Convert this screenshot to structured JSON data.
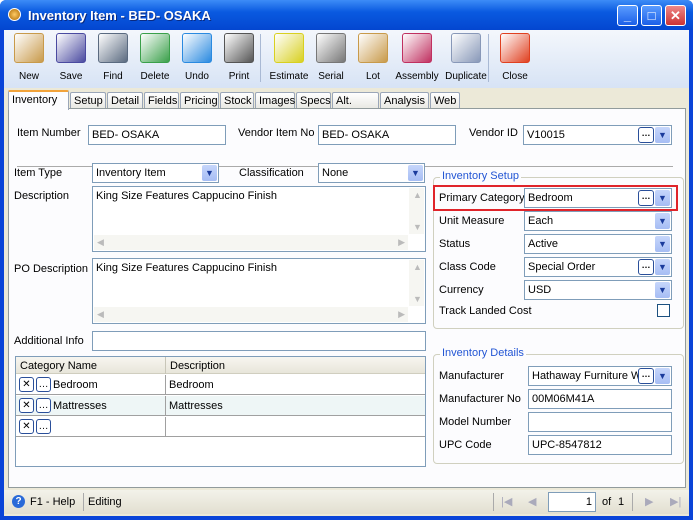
{
  "window": {
    "title": "Inventory Item - BED- OSAKA"
  },
  "toolbar": [
    {
      "label": "New",
      "icon": "new-icon",
      "color": "#c89a4a"
    },
    {
      "label": "Save",
      "icon": "save-icon",
      "color": "#4a4aa0"
    },
    {
      "label": "Find",
      "icon": "find-icon",
      "color": "#5a6a80"
    },
    {
      "label": "Delete",
      "icon": "delete-icon",
      "color": "#3aa04a"
    },
    {
      "label": "Undo",
      "icon": "undo-icon",
      "color": "#2a8ae0"
    },
    {
      "label": "Print",
      "icon": "print-icon",
      "color": "#555"
    },
    {
      "label": "Estimate",
      "icon": "estimate-icon",
      "color": "#d8d020"
    },
    {
      "label": "Serial",
      "icon": "serial-icon",
      "color": "#777"
    },
    {
      "label": "Lot",
      "icon": "lot-icon",
      "color": "#c89a4a"
    },
    {
      "label": "Assembly",
      "icon": "assembly-icon",
      "color": "#c03060"
    },
    {
      "label": "Duplicate",
      "icon": "duplicate-icon",
      "color": "#8898b8"
    },
    {
      "label": "Close",
      "icon": "close-icon",
      "color": "#e04020"
    }
  ],
  "tabs": [
    "Inventory",
    "Setup",
    "Detail",
    "Fields",
    "Pricing",
    "Stock",
    "Images",
    "Specs",
    "Alt. Vendors",
    "Analysis",
    "Web"
  ],
  "header": {
    "item_number_label": "Item Number",
    "item_number": "BED- OSAKA",
    "vendor_item_no_label": "Vendor Item No",
    "vendor_item_no": "BED- OSAKA",
    "vendor_id_label": "Vendor ID",
    "vendor_id": "V10015"
  },
  "left": {
    "item_type_label": "Item Type",
    "item_type": "Inventory Item",
    "classification_label": "Classification",
    "classification": "None",
    "description_label": "Description",
    "description": "King Size Features Cappucino Finish",
    "po_description_label": "PO Description",
    "po_description": "King Size Features Cappucino Finish",
    "additional_info_label": "Additional Info",
    "additional_info": ""
  },
  "grid": {
    "columns": [
      "Category Name",
      "Description"
    ],
    "rows": [
      [
        "Bedroom",
        "Bedroom"
      ],
      [
        "Mattresses",
        "Mattresses"
      ],
      [
        "",
        ""
      ]
    ]
  },
  "setup": {
    "title": "Inventory Setup",
    "primary_category_label": "Primary Category",
    "primary_category": "Bedroom",
    "unit_measure_label": "Unit Measure",
    "unit_measure": "Each",
    "status_label": "Status",
    "status": "Active",
    "class_code_label": "Class Code",
    "class_code": "Special Order",
    "currency_label": "Currency",
    "currency": "USD",
    "track_landed_cost_label": "Track Landed Cost",
    "track_landed_cost": false
  },
  "details": {
    "title": "Inventory Details",
    "manufacturer_label": "Manufacturer",
    "manufacturer": "Hathaway Furniture W",
    "manufacturer_no_label": "Manufacturer No",
    "manufacturer_no": "00M06M41A",
    "model_number_label": "Model Number",
    "model_number": "",
    "upc_code_label": "UPC Code",
    "upc_code": "UPC-8547812"
  },
  "statusbar": {
    "help": "F1 - Help",
    "state": "Editing",
    "page": "1",
    "of_label": "of",
    "total": "1"
  },
  "colors": {
    "highlight": "#e0242a",
    "legend": "#2255d4"
  }
}
